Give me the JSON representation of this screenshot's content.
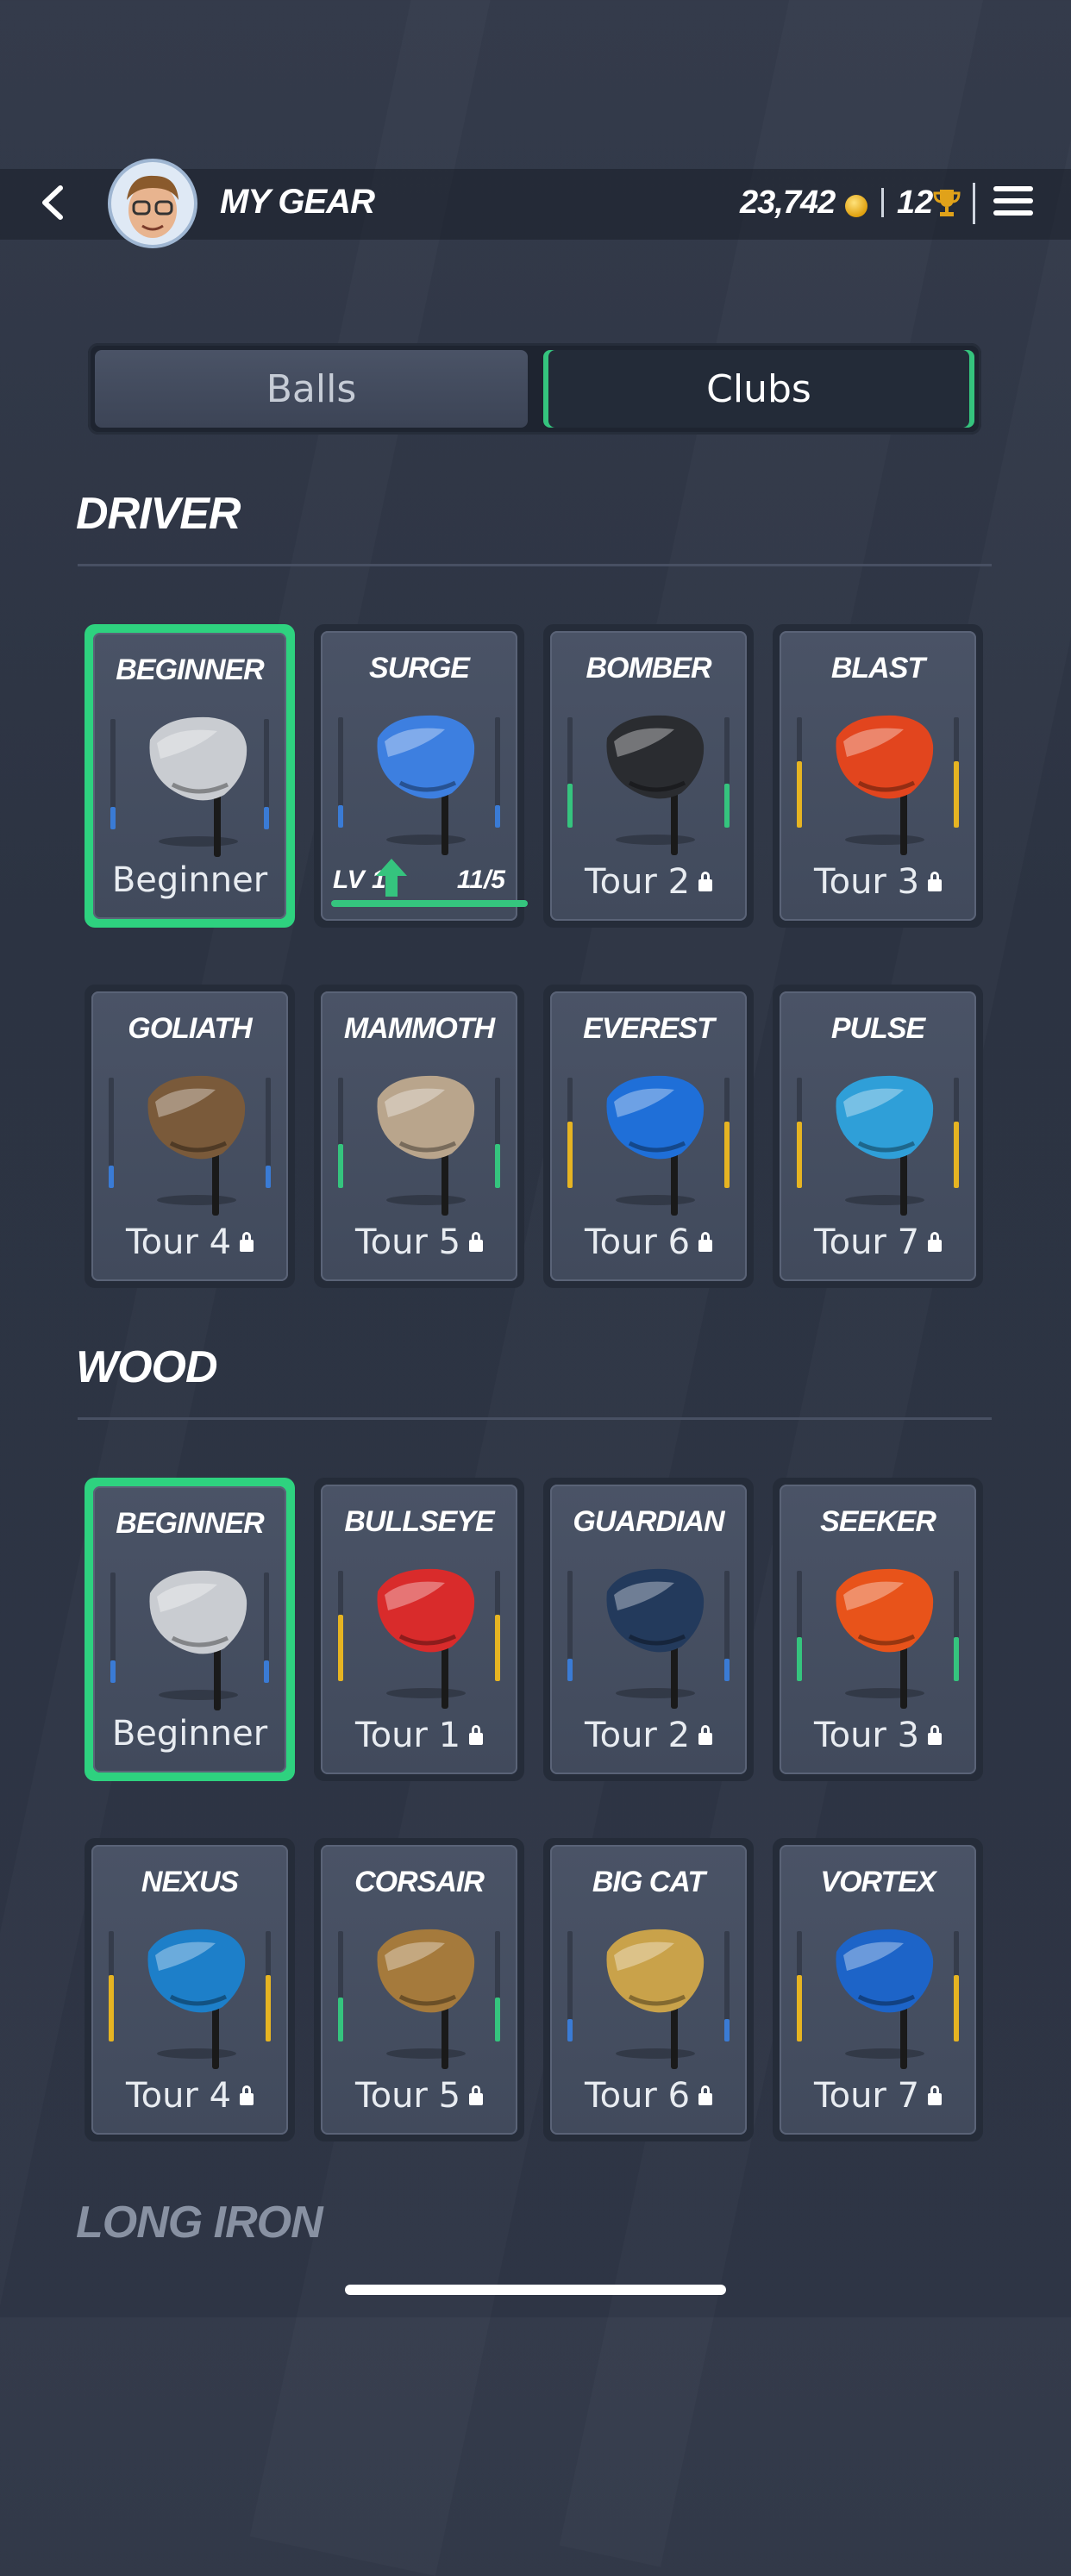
{
  "header": {
    "title": "MY GEAR",
    "coins": "23,742",
    "trophies": "12",
    "coin_icon": "coin-icon",
    "trophy_icon": "trophy-icon"
  },
  "tabs": [
    {
      "label": "Balls",
      "active": false
    },
    {
      "label": "Clubs",
      "active": true
    }
  ],
  "colors": {
    "accent": "#35c47e",
    "bar_blue": "#3a7bd5",
    "bar_green": "#35c47e",
    "bar_yellow": "#e6b422",
    "background": "#2e3545"
  },
  "sections": [
    {
      "title": "DRIVER",
      "items": [
        {
          "name": "BEGINNER",
          "label": "Beginner",
          "locked": false,
          "selected": true,
          "bar": "blue",
          "level": 0.2
        },
        {
          "name": "SURGE",
          "label": "",
          "locked": false,
          "selected": false,
          "bar": "blue",
          "level": 0.2,
          "upgrade": {
            "level": "LV 1",
            "count": "11/5",
            "progress": 1
          }
        },
        {
          "name": "BOMBER",
          "label": "Tour 2",
          "locked": true,
          "selected": false,
          "bar": "green",
          "level": 0.4
        },
        {
          "name": "BLAST",
          "label": "Tour 3",
          "locked": true,
          "selected": false,
          "bar": "yellow",
          "level": 0.6
        },
        {
          "name": "GOLIATH",
          "label": "Tour 4",
          "locked": true,
          "selected": false,
          "bar": "blue",
          "level": 0.2
        },
        {
          "name": "MAMMOTH",
          "label": "Tour 5",
          "locked": true,
          "selected": false,
          "bar": "green",
          "level": 0.4
        },
        {
          "name": "EVEREST",
          "label": "Tour 6",
          "locked": true,
          "selected": false,
          "bar": "yellow",
          "level": 0.6
        },
        {
          "name": "PULSE",
          "label": "Tour 7",
          "locked": true,
          "selected": false,
          "bar": "yellow",
          "level": 0.6
        }
      ]
    },
    {
      "title": "WOOD",
      "items": [
        {
          "name": "BEGINNER",
          "label": "Beginner",
          "locked": false,
          "selected": true,
          "bar": "blue",
          "level": 0.2
        },
        {
          "name": "BULLSEYE",
          "label": "Tour 1",
          "locked": true,
          "selected": false,
          "bar": "yellow",
          "level": 0.6
        },
        {
          "name": "GUARDIAN",
          "label": "Tour 2",
          "locked": true,
          "selected": false,
          "bar": "blue",
          "level": 0.2
        },
        {
          "name": "SEEKER",
          "label": "Tour 3",
          "locked": true,
          "selected": false,
          "bar": "green",
          "level": 0.4
        },
        {
          "name": "NEXUS",
          "label": "Tour 4",
          "locked": true,
          "selected": false,
          "bar": "yellow",
          "level": 0.6
        },
        {
          "name": "CORSAIR",
          "label": "Tour 5",
          "locked": true,
          "selected": false,
          "bar": "green",
          "level": 0.4
        },
        {
          "name": "BIG CAT",
          "label": "Tour 6",
          "locked": true,
          "selected": false,
          "bar": "blue",
          "level": 0.2
        },
        {
          "name": "VORTEX",
          "label": "Tour 7",
          "locked": true,
          "selected": false,
          "bar": "yellow",
          "level": 0.6
        }
      ]
    }
  ],
  "next_section": "LONG IRON",
  "club_colors": {
    "DRIVER": [
      "#c9ccd1",
      "#3d7fe0",
      "#2a2c30",
      "#e2451e",
      "#7a5a3a",
      "#b9a58c",
      "#1f6fd8",
      "#2f9fd8"
    ],
    "WOOD": [
      "#c9ccd1",
      "#d92b2b",
      "#233a5c",
      "#e8531a",
      "#1d7fc9",
      "#a57a3c",
      "#c9a24a",
      "#1d64c8"
    ]
  }
}
